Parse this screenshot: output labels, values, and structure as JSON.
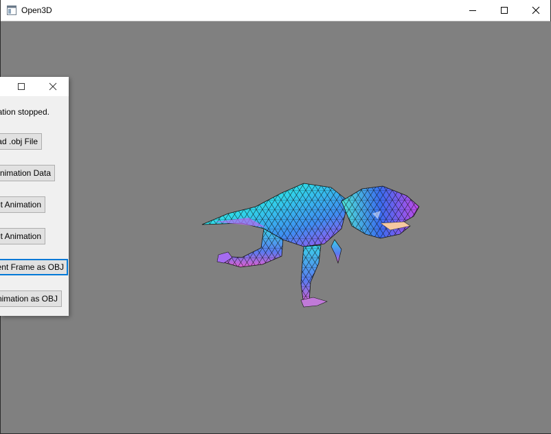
{
  "window": {
    "title": "Open3D",
    "icon": "app-window-icon",
    "controls": [
      "minimize-icon",
      "maximize-icon",
      "close-icon"
    ]
  },
  "viewport": {
    "background_color": "#808080",
    "content": "trex-mesh-icon"
  },
  "panel": {
    "controls": [
      "maximize-icon",
      "close-icon"
    ],
    "status": "ation stopped.",
    "buttons": [
      {
        "label": "ad .obj File"
      },
      {
        "label": "nimation Data"
      },
      {
        "label": "t Animation"
      },
      {
        "label": "t Animation"
      },
      {
        "label": "rrent Frame as OBJ"
      },
      {
        "label": "nimation as OBJ"
      }
    ]
  },
  "colors": {
    "button_face": "#e1e1e1",
    "button_border": "#adadad",
    "focus_border": "#0078d7",
    "panel_bg": "#f0f0f0"
  }
}
